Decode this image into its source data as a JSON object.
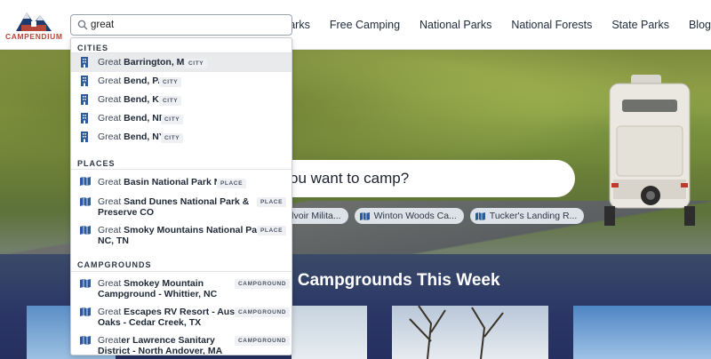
{
  "brand": {
    "name": "CAMPENDIUM"
  },
  "nav": {
    "items": [
      "RV Parks",
      "Free Camping",
      "National Parks",
      "National Forests",
      "State Parks",
      "Blog"
    ]
  },
  "search": {
    "value": "great",
    "icon": "search-icon"
  },
  "dropdown": {
    "cities_title": "CITIES",
    "places_title": "PLACES",
    "campgrounds_title": "CAMPGROUNDS",
    "cities": [
      {
        "match": "Great",
        "rest": " Barrington, MA",
        "badge": "CITY"
      },
      {
        "match": "Great",
        "rest": " Bend, PA",
        "badge": "CITY"
      },
      {
        "match": "Great",
        "rest": " Bend, KS",
        "badge": "CITY"
      },
      {
        "match": "Great",
        "rest": " Bend, ND",
        "badge": "CITY"
      },
      {
        "match": "Great",
        "rest": " Bend, NY",
        "badge": "CITY"
      }
    ],
    "places": [
      {
        "match": "Great",
        "rest_line1": " Basin National Park NV",
        "rest_line2": "",
        "badge": "PLACE"
      },
      {
        "match": "Great",
        "rest_line1": " Sand Dunes National Park &",
        "rest_line2": "Preserve CO",
        "badge": "PLACE"
      },
      {
        "match": "Great",
        "rest_line1": " Smoky Mountains National Park",
        "rest_line2": "NC, TN",
        "badge": "PLACE"
      }
    ],
    "campgrounds": [
      {
        "match": "Great",
        "rest_line1": " Smokey Mountain",
        "rest_line2": "Campground - Whittier, NC",
        "badge": "CAMPGROUND"
      },
      {
        "match": "Great",
        "rest_line1": " Escapes RV Resort - Austin",
        "rest_line2": "Oaks - Cedar Creek, TX",
        "badge": "CAMPGROUND"
      },
      {
        "match": "Great",
        "rest_line1": "er Lawrence Sanitary",
        "rest_line2": "District - North Andover, MA",
        "badge": "CAMPGROUND"
      }
    ]
  },
  "hero": {
    "search_text": "ou want to camp?",
    "chips": [
      "rt Belvoir Milita...",
      "Winton Woods Ca...",
      "Tucker's Landing R..."
    ],
    "heading": "o Campgrounds This Week"
  },
  "colors": {
    "brand_red": "#b5473a",
    "navy": "#1e3a6e",
    "icon_blue": "#2d5a9e"
  }
}
